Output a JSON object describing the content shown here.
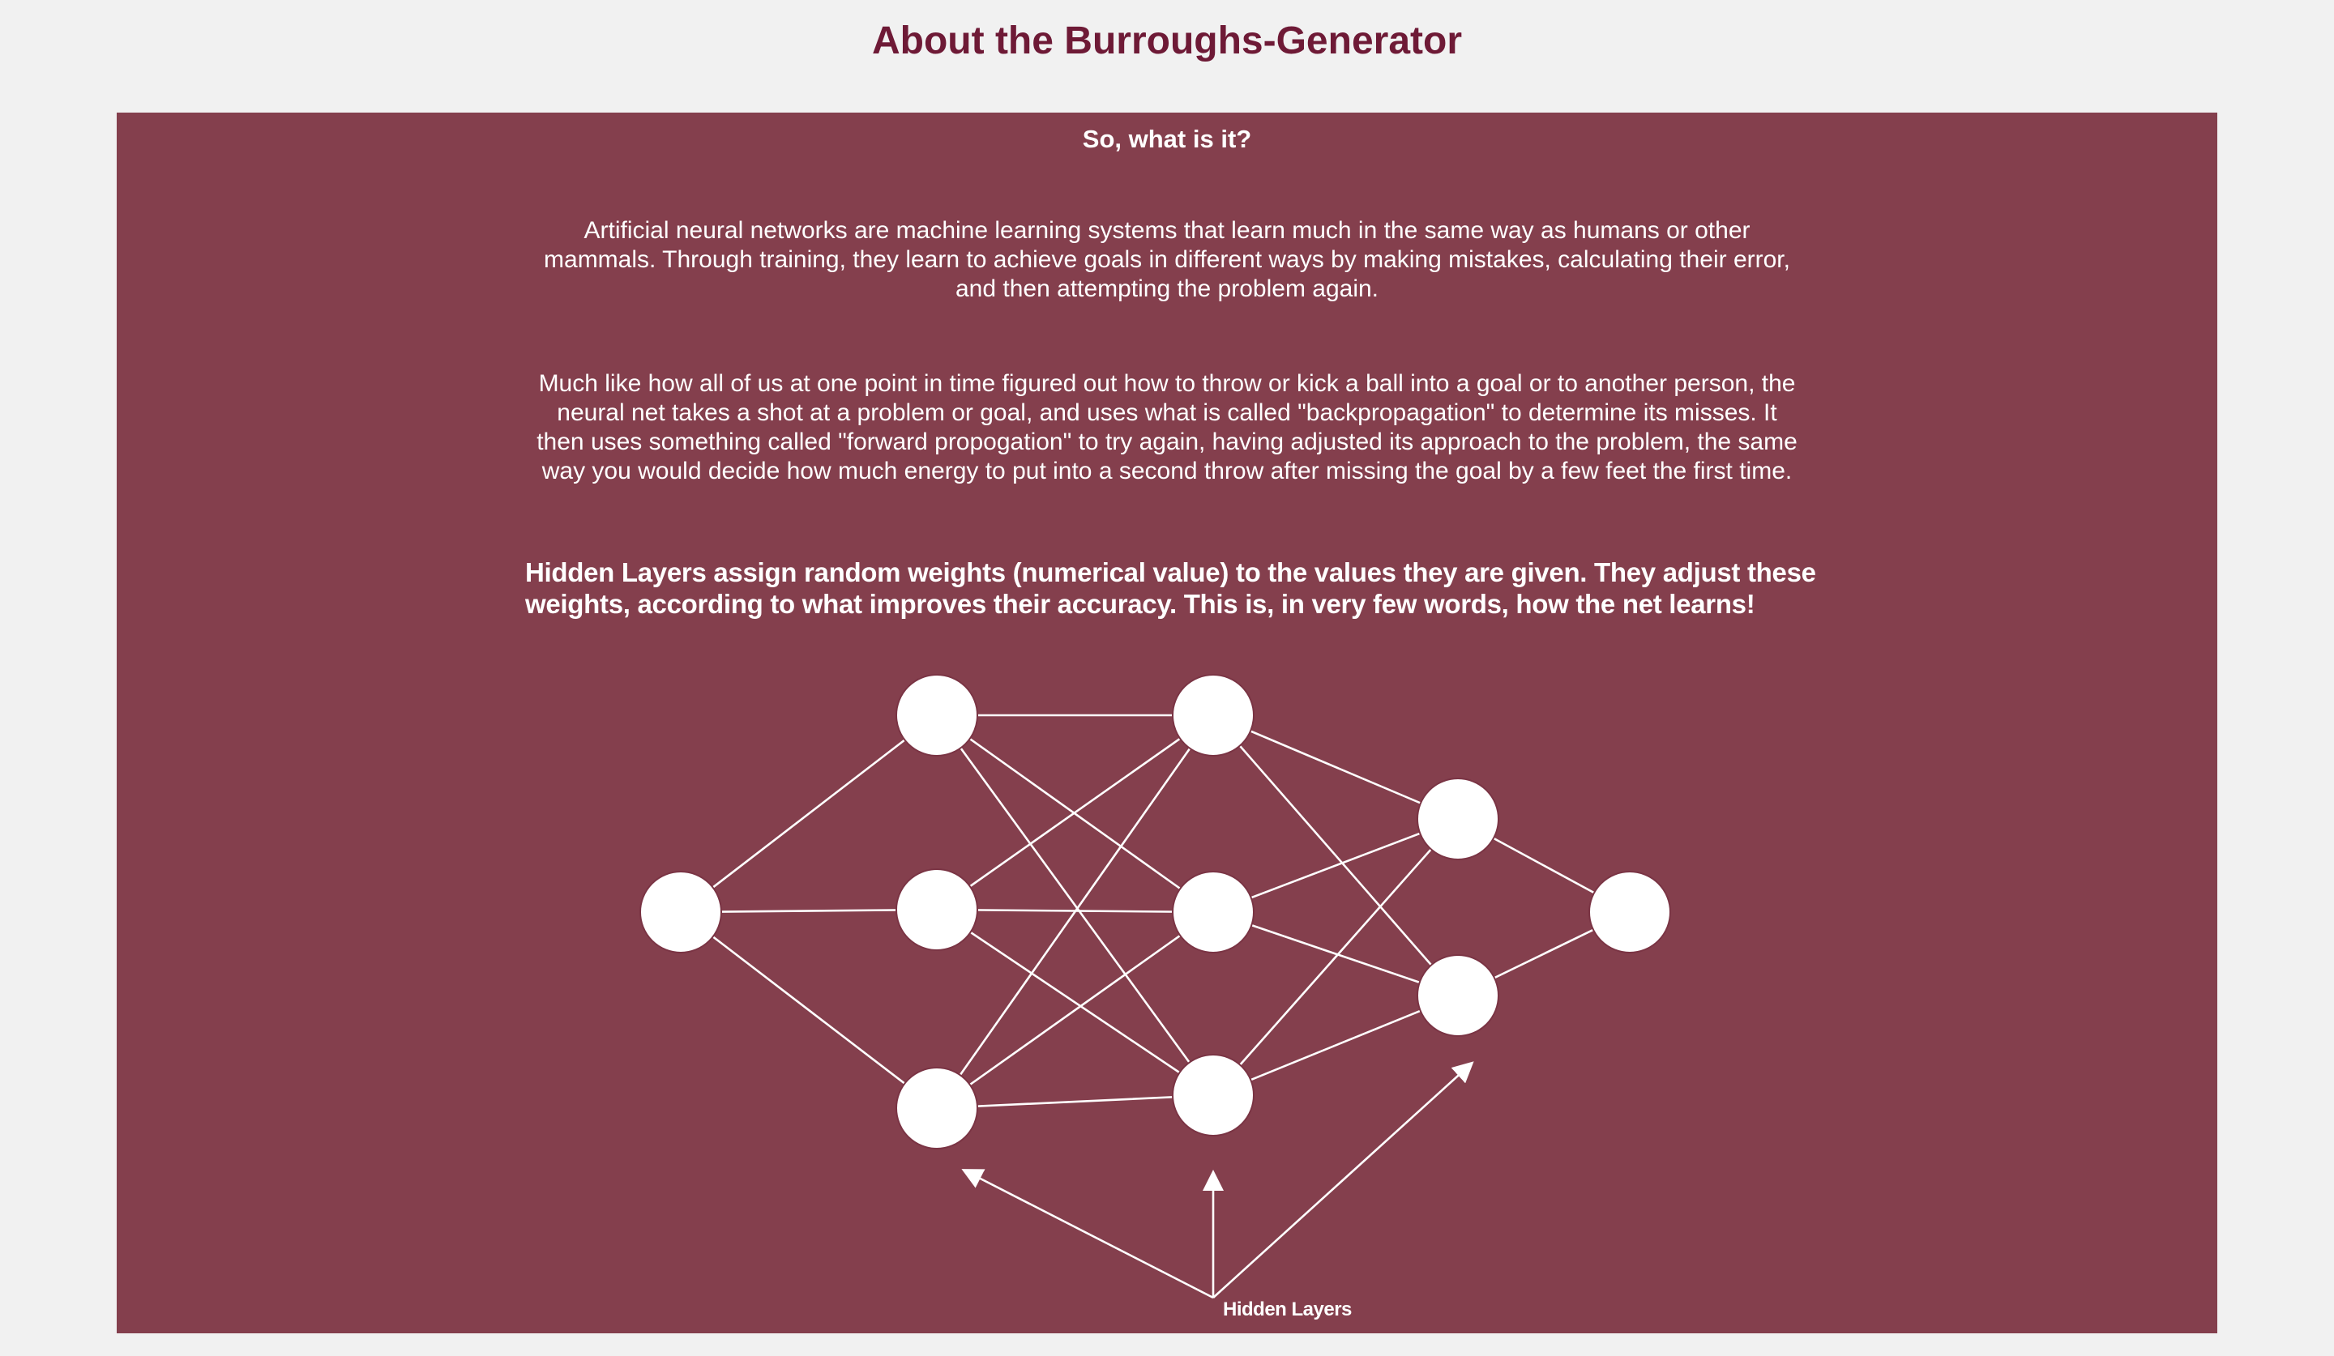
{
  "page": {
    "title": "About the Burroughs-Generator"
  },
  "panel": {
    "heading": "So, what is it?",
    "paragraph_1": "Artificial neural networks are machine learning systems that learn much in the same way as humans or other mammals. Through training, they learn to achieve goals in different ways by making mistakes, calculating their error, and then attempting the problem again.",
    "paragraph_2": "Much like how all of us at one point in time figured out how to throw or kick a ball into a goal or to another person, the neural net takes a shot at a problem or goal, and uses what is called \"backpropagation\" to determine its misses. It then uses something called \"forward propogation\" to try again, having adjusted its approach to the problem, the same way you would decide how much energy to put into a second throw after missing the goal by a few feet the first time.",
    "hidden_layers_note": "Hidden Layers assign random weights (numerical value) to the values they are given. They adjust these weights, according to what improves their accuracy. This is, in very few words, how the net learns!"
  },
  "diagram": {
    "hidden_layers_label": "Hidden Layers",
    "colors": {
      "node_fill": "#ffffff",
      "edge_stroke": "#ffffff",
      "panel_background": "#843f4d",
      "title_color": "#6e1a36"
    }
  }
}
